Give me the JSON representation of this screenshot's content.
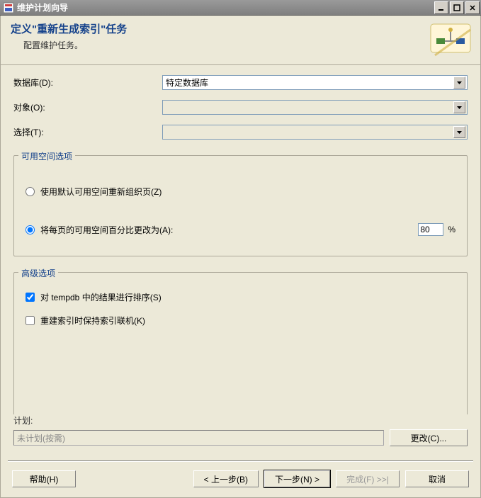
{
  "window": {
    "title": "维护计划向导"
  },
  "header": {
    "title": "定义\"重新生成索引\"任务",
    "subtitle": "配置维护任务。"
  },
  "fields": {
    "database_label": "数据库(D):",
    "database_value": "特定数据库",
    "object_label": "对象(O):",
    "object_value": "",
    "select_label": "选择(T):",
    "select_value": ""
  },
  "free_space": {
    "group_title": "可用空间选项",
    "opt_default": "使用默认可用空间重新组织页(Z)",
    "opt_change": "将每页的可用空间百分比更改为(A):",
    "percent_value": "80",
    "percent_unit": "%"
  },
  "advanced": {
    "group_title": "高级选项",
    "sort_tempdb": "对 tempdb 中的结果进行排序(S)",
    "keep_online": "重建索引时保持索引联机(K)"
  },
  "schedule": {
    "label": "计划:",
    "value": "未计划(按需)",
    "change_btn": "更改(C)..."
  },
  "footer": {
    "help": "帮助(H)",
    "back": "< 上一步(B)",
    "next": "下一步(N) >",
    "finish": "完成(F) >>|",
    "cancel": "取消"
  }
}
